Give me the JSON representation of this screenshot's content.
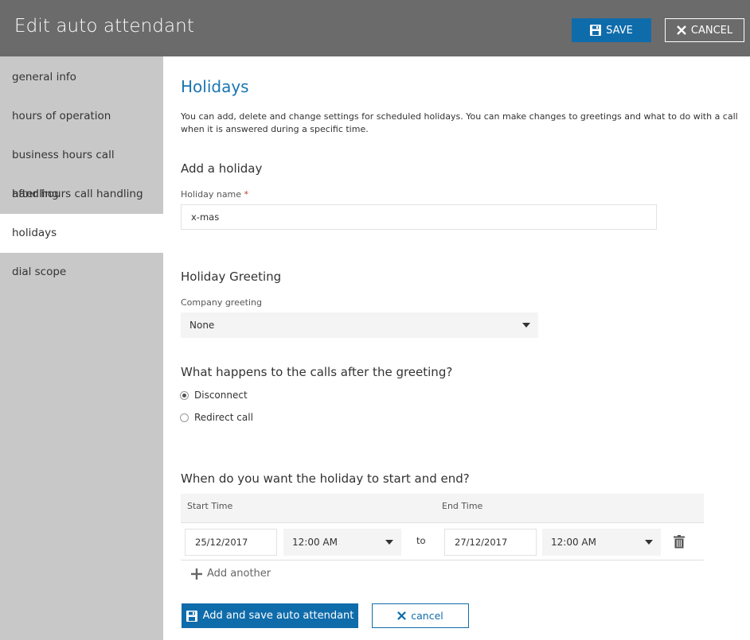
{
  "header": {
    "title": "Edit auto attendant",
    "save_label": "SAVE",
    "cancel_label": "CANCEL"
  },
  "sidebar": {
    "items": [
      {
        "label": "general info",
        "active": false
      },
      {
        "label": "hours of operation",
        "active": false
      },
      {
        "label": "business hours call handling",
        "active": false
      },
      {
        "label": "after hours call handling",
        "active": false
      },
      {
        "label": "holidays",
        "active": true
      },
      {
        "label": "dial scope",
        "active": false
      }
    ]
  },
  "main": {
    "title": "Holidays",
    "description": "You can add, delete and change settings for scheduled holidays. You can make changes to greetings and what to do with a call when it is answered during a specific time.",
    "add_holiday": {
      "heading": "Add a holiday",
      "name_label": "Holiday name",
      "required_mark": "*",
      "name_value": "x-mas"
    },
    "greeting": {
      "heading": "Holiday Greeting",
      "label": "Company greeting",
      "selected": "None"
    },
    "after_greeting": {
      "heading": "What happens to the calls after the greeting?",
      "options": [
        {
          "label": "Disconnect",
          "checked": true
        },
        {
          "label": "Redirect call",
          "checked": false
        }
      ]
    },
    "schedule": {
      "heading": "When do you want the holiday to start and end?",
      "start_label": "Start Time",
      "end_label": "End Time",
      "start_date": "25/12/2017",
      "start_time": "12:00 AM",
      "to_label": "to",
      "end_date": "27/12/2017",
      "end_time": "12:00 AM",
      "add_another": "Add another"
    },
    "actions": {
      "save_label": "Add and save auto attendant",
      "cancel_label": "cancel"
    }
  },
  "colors": {
    "accent": "#0f6cab",
    "title_blue": "#1a75b1",
    "header_bg": "#6b6b6b",
    "sidebar_bg": "#c8c8c8"
  }
}
